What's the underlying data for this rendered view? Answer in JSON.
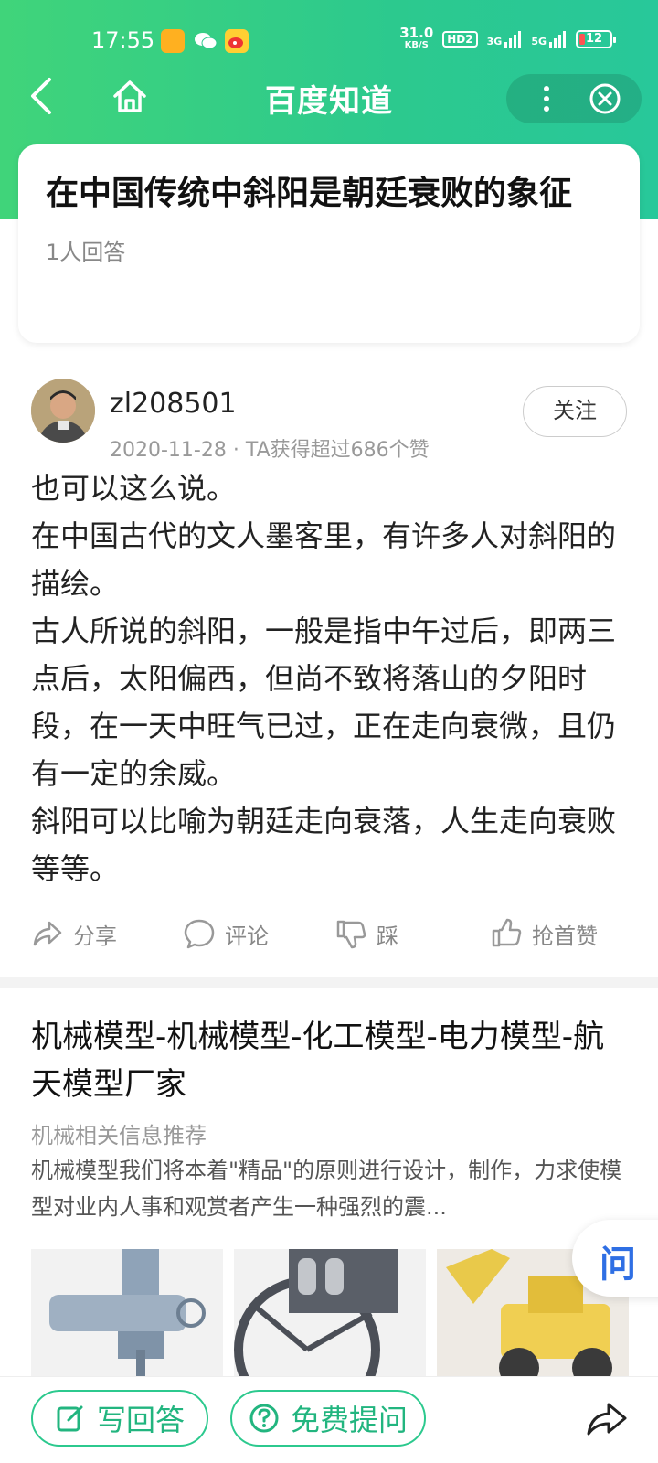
{
  "status_bar": {
    "time": "17:55",
    "speed_value": "31.0",
    "speed_unit": "KB/S",
    "hd_label": "HD2",
    "net1": "3G",
    "net2": "5G",
    "battery": "12"
  },
  "navbar": {
    "title": "百度知道"
  },
  "question": {
    "title": "在中国传统中斜阳是朝廷衰败的象征",
    "answer_count": "1人回答"
  },
  "answer": {
    "username": "zl208501",
    "meta": "2020-11-28 · TA获得超过686个赞",
    "follow_label": "关注",
    "paragraphs": [
      "也可以这么说。",
      "在中国古代的文人墨客里，有许多人对斜阳的描绘。",
      "古人所说的斜阳，一般是指中午过后，即两三点后，太阳偏西，但尚不致将落山的夕阳时段，在一天中旺气已过，正在走向衰微，且仍有一定的余威。",
      "斜阳可以比喻为朝廷走向衰落，人生走向衰败等等。"
    ],
    "actions": {
      "share": "分享",
      "comment": "评论",
      "dislike": "踩",
      "like": "抢首赞"
    }
  },
  "ad": {
    "title": "机械模型-机械模型-化工模型-电力模型-航天模型厂家",
    "source": "机械相关信息推荐",
    "description": "机械模型我们将本着\"精品\"的原则进行设计，制作，力求使模型对业内人事和观赏者产生一种强烈的震..."
  },
  "float_ask": "问",
  "bottom": {
    "write_answer": "写回答",
    "free_ask": "免费提问"
  },
  "colors": {
    "brand_green": "#2cc98e",
    "ask_blue": "#2f6fe4"
  }
}
